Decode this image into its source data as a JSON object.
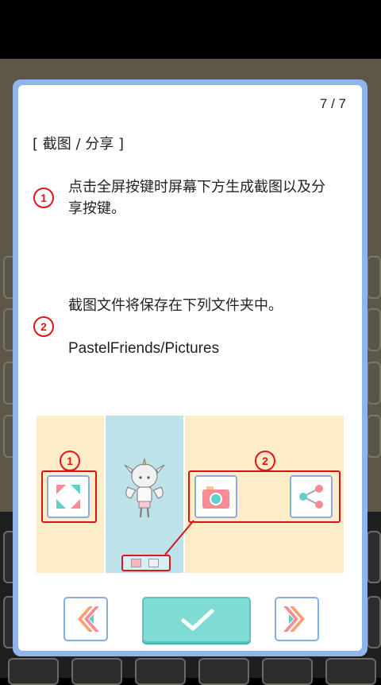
{
  "pager": "7 / 7",
  "section_title": "[ 截图 / 分享 ]",
  "items": [
    {
      "num": "1",
      "text_line1": "点击全屏按键时屏幕下方生成截图以及分",
      "text_line2": "享按键。"
    },
    {
      "num": "2",
      "text_line1": "截图文件将保存在下列文件夹中。",
      "text_line2": "PastelFriends/Pictures"
    }
  ],
  "illustration": {
    "label_1": "1",
    "label_2": "2",
    "icons": [
      "fullscreen-icon",
      "camera-icon",
      "share-icon"
    ]
  },
  "nav": {
    "prev": "double-chevron-left-icon",
    "confirm": "checkmark-icon",
    "next": "double-chevron-right-icon"
  },
  "colors": {
    "modal_border": "#8fb5ea",
    "accent_red": "#e0141c",
    "confirm_teal": "#7fdcd4",
    "illus_left": "#fdecc8",
    "illus_center": "#bde2ea"
  }
}
